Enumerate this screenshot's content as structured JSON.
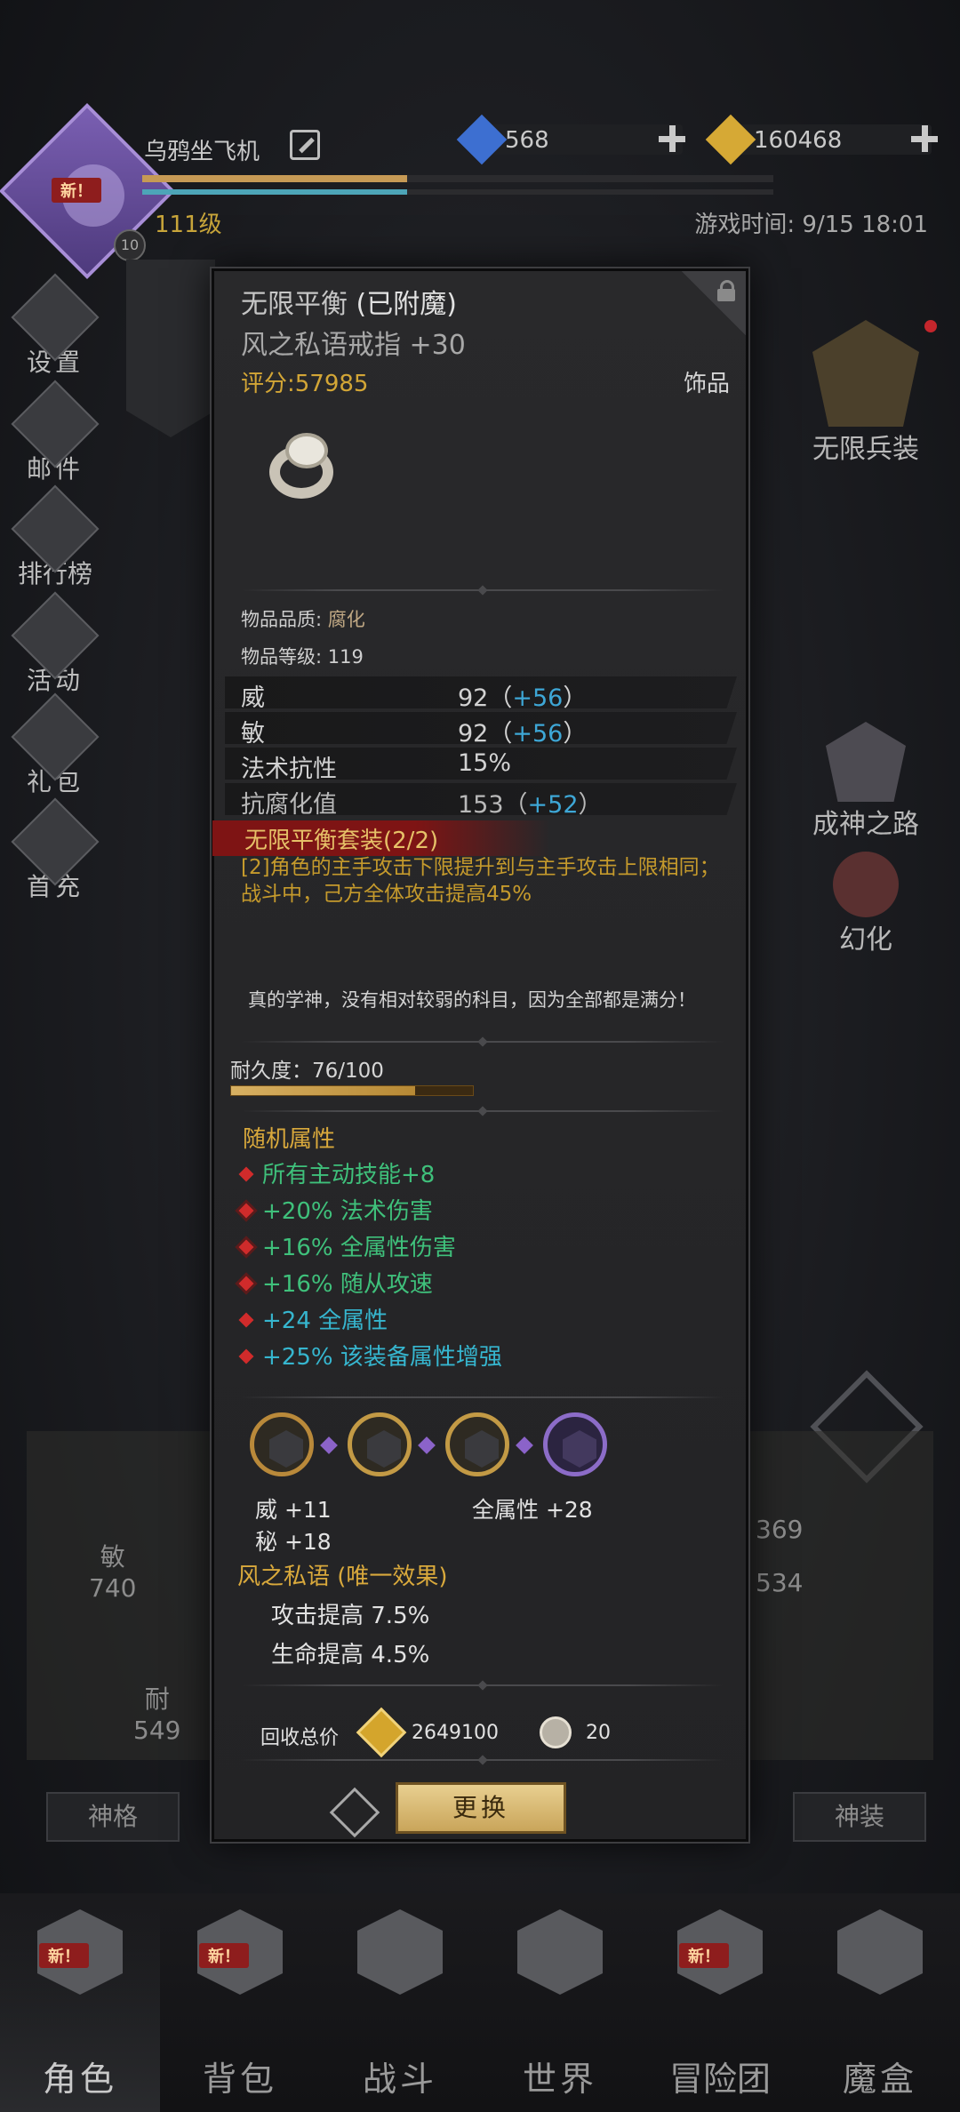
{
  "header": {
    "player_name": "乌鸦坐飞机",
    "level": "111级",
    "level_badge": "10",
    "game_time": "游戏时间: 9/15 18:01",
    "exp_progress": 0.42,
    "hp_progress": 0.42,
    "avatar_new_tag": "新！",
    "currencies": [
      {
        "icon": "blue-gem-icon",
        "value": "568",
        "color": "#3d6fd1"
      },
      {
        "icon": "gold-gem-icon",
        "value": "160468",
        "color": "#d6a935"
      }
    ]
  },
  "side_menu": [
    {
      "label": "设置",
      "icon": "gear-icon"
    },
    {
      "label": "邮件",
      "icon": "mail-icon"
    },
    {
      "label": "排行榜",
      "icon": "ranking-icon"
    },
    {
      "label": "活动",
      "icon": "activity-icon"
    },
    {
      "label": "礼包",
      "icon": "gift-icon"
    },
    {
      "label": "首充",
      "icon": "first-recharge-icon"
    }
  ],
  "right_menu": [
    {
      "label": "无限兵装",
      "icon": "infinite-armament-icon"
    },
    {
      "label": "成神之路",
      "icon": "godhood-road-icon"
    },
    {
      "label": "幻化",
      "icon": "transmog-icon"
    }
  ],
  "background_panel": {
    "stats": [
      {
        "label": "敏",
        "value": "740"
      },
      {
        "label": "耐",
        "value": "549"
      }
    ],
    "right_values": [
      "369",
      "534"
    ],
    "buttons": [
      "神格",
      "神装"
    ]
  },
  "tooltip": {
    "title": "无限平衡",
    "enchant": "(已附魔)",
    "subtitle": "风之私语戒指 +30",
    "score": "评分:57985",
    "item_type": "饰品",
    "quality_label": "物品品质:",
    "quality_value": "腐化",
    "item_level_label": "物品等级:",
    "item_level_value": "119",
    "stats": [
      {
        "name": "威",
        "value": "92（",
        "bonus": "+56",
        "close": "）"
      },
      {
        "name": "敏",
        "value": "92（",
        "bonus": "+56",
        "close": "）"
      },
      {
        "name": "法术抗性",
        "value": "15%",
        "bonus": "",
        "close": ""
      },
      {
        "name": "抗腐化值",
        "value": "153（",
        "bonus": "+52",
        "close": "）"
      }
    ],
    "set_title": "无限平衡套装(2/2)",
    "set_desc": "[2]角色的主手攻击下限提升到与主手攻击上限相同；战斗中，己方全体攻击提高45%",
    "flavor": "真的学神，没有相对较弱的科目，因为全部都是满分！",
    "durability_label": "耐久度：76/100",
    "durability": 0.76,
    "random_title": "随机属性",
    "random_attrs": [
      {
        "text": "所有主动技能+8",
        "color": "green"
      },
      {
        "text": "+20% 法术伤害",
        "color": "green"
      },
      {
        "text": "+16% 全属性伤害",
        "color": "green"
      },
      {
        "text": "+16% 随从攻速",
        "color": "green"
      },
      {
        "text": "+24 全属性",
        "color": "cyan"
      },
      {
        "text": "+25% 该装备属性增强",
        "color": "cyan"
      }
    ],
    "gem_stats": [
      "威 +11",
      "全属性 +28",
      "秘 +18"
    ],
    "unique_title": "风之私语 (唯一效果)",
    "unique_lines": [
      "攻击提高 7.5%",
      "生命提高 4.5%"
    ],
    "recycle_label": "回收总价",
    "recycle_gold": "2649100",
    "recycle_silver": "20",
    "replace_button": "更换"
  },
  "bottom_nav": [
    {
      "label": "角色",
      "icon": "character-icon",
      "new": "新！"
    },
    {
      "label": "背包",
      "icon": "backpack-icon",
      "new": "新！"
    },
    {
      "label": "战斗",
      "icon": "battle-icon",
      "new": ""
    },
    {
      "label": "世界",
      "icon": "world-map-icon",
      "new": ""
    },
    {
      "label": "冒险团",
      "icon": "adventure-team-icon",
      "new": "新！"
    },
    {
      "label": "魔盒",
      "icon": "magic-box-icon",
      "new": ""
    }
  ]
}
